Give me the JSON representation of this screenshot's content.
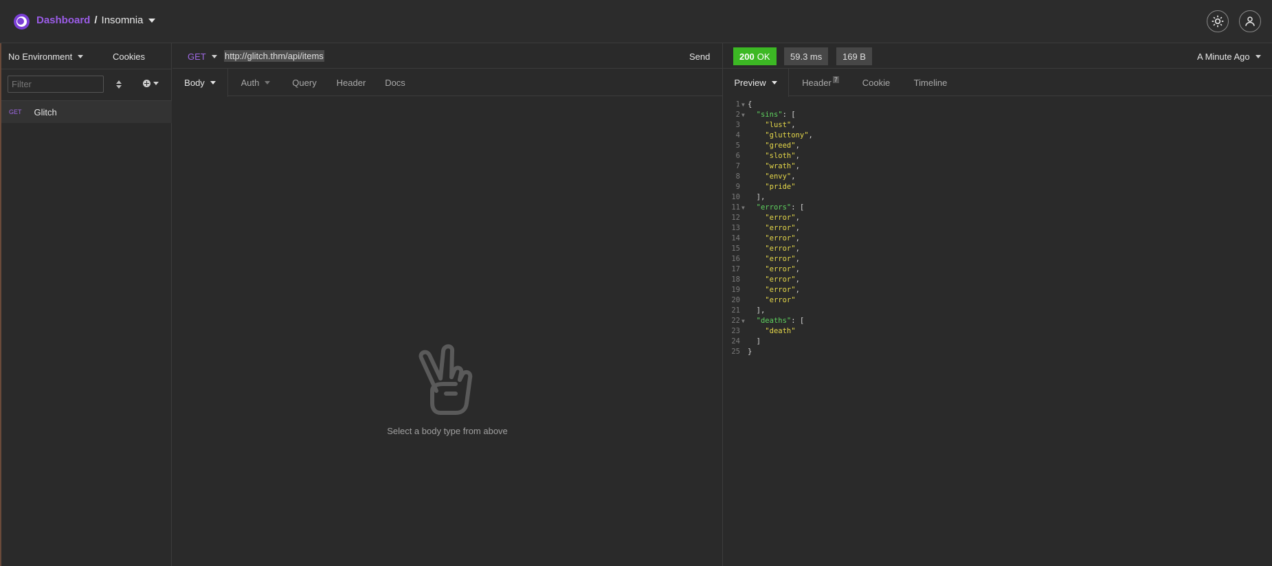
{
  "topbar": {
    "dashboard_label": "Dashboard",
    "separator": "/",
    "workspace_name": "Insomnia"
  },
  "sidebar": {
    "environment_label": "No Environment",
    "cookies_label": "Cookies",
    "filter_placeholder": "Filter",
    "requests": [
      {
        "method": "GET",
        "name": "Glitch"
      }
    ]
  },
  "request": {
    "method": "GET",
    "url": "http://glitch.thm/api/items",
    "send_label": "Send",
    "tabs": [
      "Body",
      "Auth",
      "Query",
      "Header",
      "Docs"
    ],
    "active_tab": "Body",
    "empty_message": "Select a body type from above"
  },
  "response": {
    "status_code": "200",
    "status_text": "OK",
    "status_color": "#3cb824",
    "time": "59.3 ms",
    "size": "169 B",
    "time_ago": "A Minute Ago",
    "tabs": [
      "Preview",
      "Header",
      "Cookie",
      "Timeline"
    ],
    "header_count": "7",
    "active_tab": "Preview",
    "body_lines": [
      {
        "n": "1",
        "fold": true,
        "text": "{"
      },
      {
        "n": "2",
        "fold": true,
        "key": "\"sins\"",
        "text": ": ["
      },
      {
        "n": "3",
        "str": "\"lust\"",
        "text": ","
      },
      {
        "n": "4",
        "str": "\"gluttony\"",
        "text": ","
      },
      {
        "n": "5",
        "str": "\"greed\"",
        "text": ","
      },
      {
        "n": "6",
        "str": "\"sloth\"",
        "text": ","
      },
      {
        "n": "7",
        "str": "\"wrath\"",
        "text": ","
      },
      {
        "n": "8",
        "str": "\"envy\"",
        "text": ","
      },
      {
        "n": "9",
        "str": "\"pride\"",
        "text": ""
      },
      {
        "n": "10",
        "text": "],"
      },
      {
        "n": "11",
        "fold": true,
        "key": "\"errors\"",
        "text": ": ["
      },
      {
        "n": "12",
        "str": "\"error\"",
        "text": ","
      },
      {
        "n": "13",
        "str": "\"error\"",
        "text": ","
      },
      {
        "n": "14",
        "str": "\"error\"",
        "text": ","
      },
      {
        "n": "15",
        "str": "\"error\"",
        "text": ","
      },
      {
        "n": "16",
        "str": "\"error\"",
        "text": ","
      },
      {
        "n": "17",
        "str": "\"error\"",
        "text": ","
      },
      {
        "n": "18",
        "str": "\"error\"",
        "text": ","
      },
      {
        "n": "19",
        "str": "\"error\"",
        "text": ","
      },
      {
        "n": "20",
        "str": "\"error\"",
        "text": ""
      },
      {
        "n": "21",
        "text": "],"
      },
      {
        "n": "22",
        "fold": true,
        "key": "\"deaths\"",
        "text": ": ["
      },
      {
        "n": "23",
        "str": "\"death\"",
        "text": ""
      },
      {
        "n": "24",
        "text": "]"
      },
      {
        "n": "25",
        "text": "}"
      }
    ],
    "indent_levels": [
      0,
      1,
      2,
      2,
      2,
      2,
      2,
      2,
      2,
      1,
      1,
      2,
      2,
      2,
      2,
      2,
      2,
      2,
      2,
      2,
      1,
      1,
      2,
      1,
      0
    ]
  },
  "icons": {
    "logo": "insomnia-logo-icon",
    "settings": "gear-icon",
    "account": "user-icon",
    "empty_state": "peace-hand-icon"
  }
}
